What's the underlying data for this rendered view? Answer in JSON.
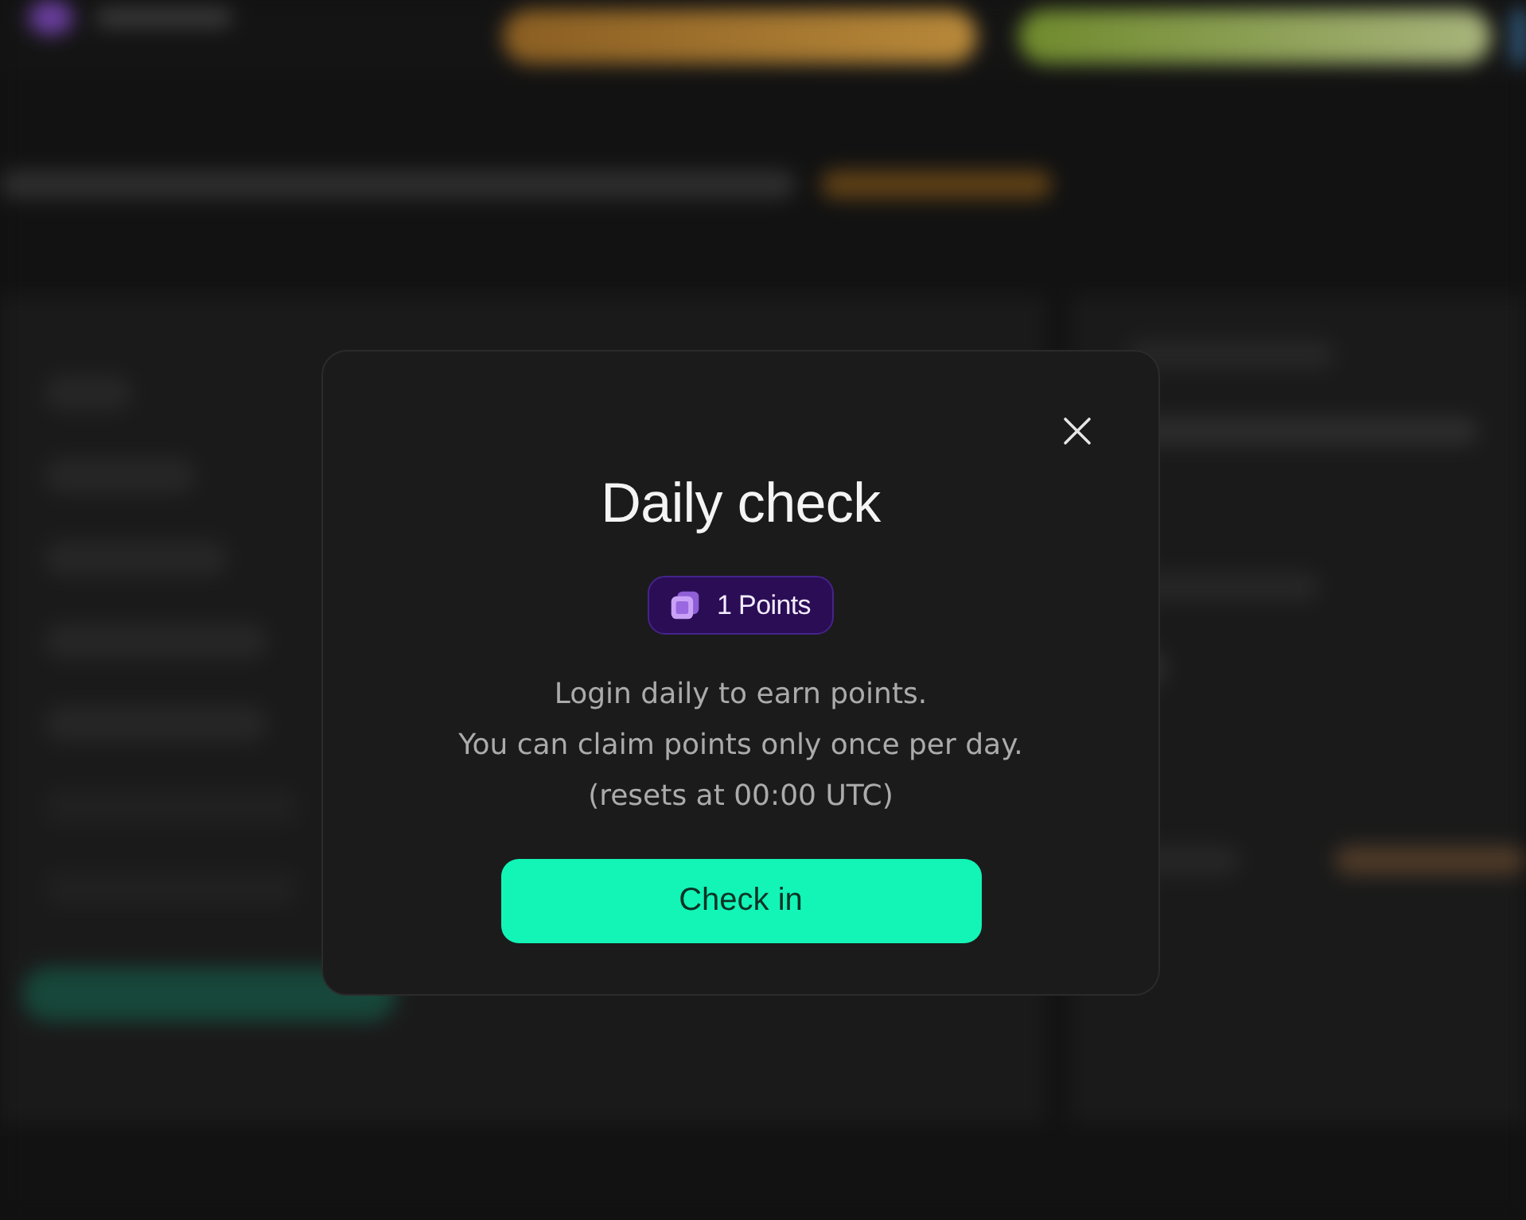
{
  "modal": {
    "title": "Daily check",
    "reward_badge": {
      "label": "1 Points"
    },
    "description_lines": [
      "Login daily to earn points.",
      "You can claim points only once per day.",
      "(resets at 00:00 UTC)"
    ],
    "primary_button": {
      "label": "Check in"
    }
  }
}
